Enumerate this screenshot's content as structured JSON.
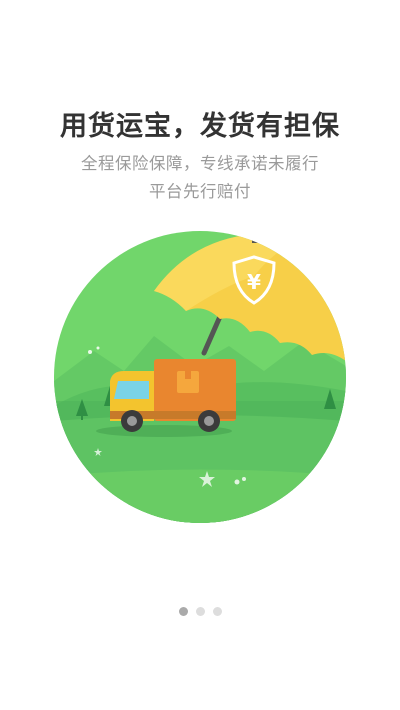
{
  "guide": {
    "title": "用货运宝，发货有担保",
    "subtitle_line1": "全程保险保障，专线承诺未履行",
    "subtitle_line2": "平台先行赔付",
    "currency_symbol": "¥"
  },
  "pager": {
    "count": 3,
    "active_index": 0
  },
  "colors": {
    "green_bg": "#6fd46b",
    "umbrella": "#f7cf48",
    "truck_cab": "#f3c42e",
    "truck_box": "#e9862f",
    "title": "#333333",
    "subtitle": "#9a9a9a"
  }
}
